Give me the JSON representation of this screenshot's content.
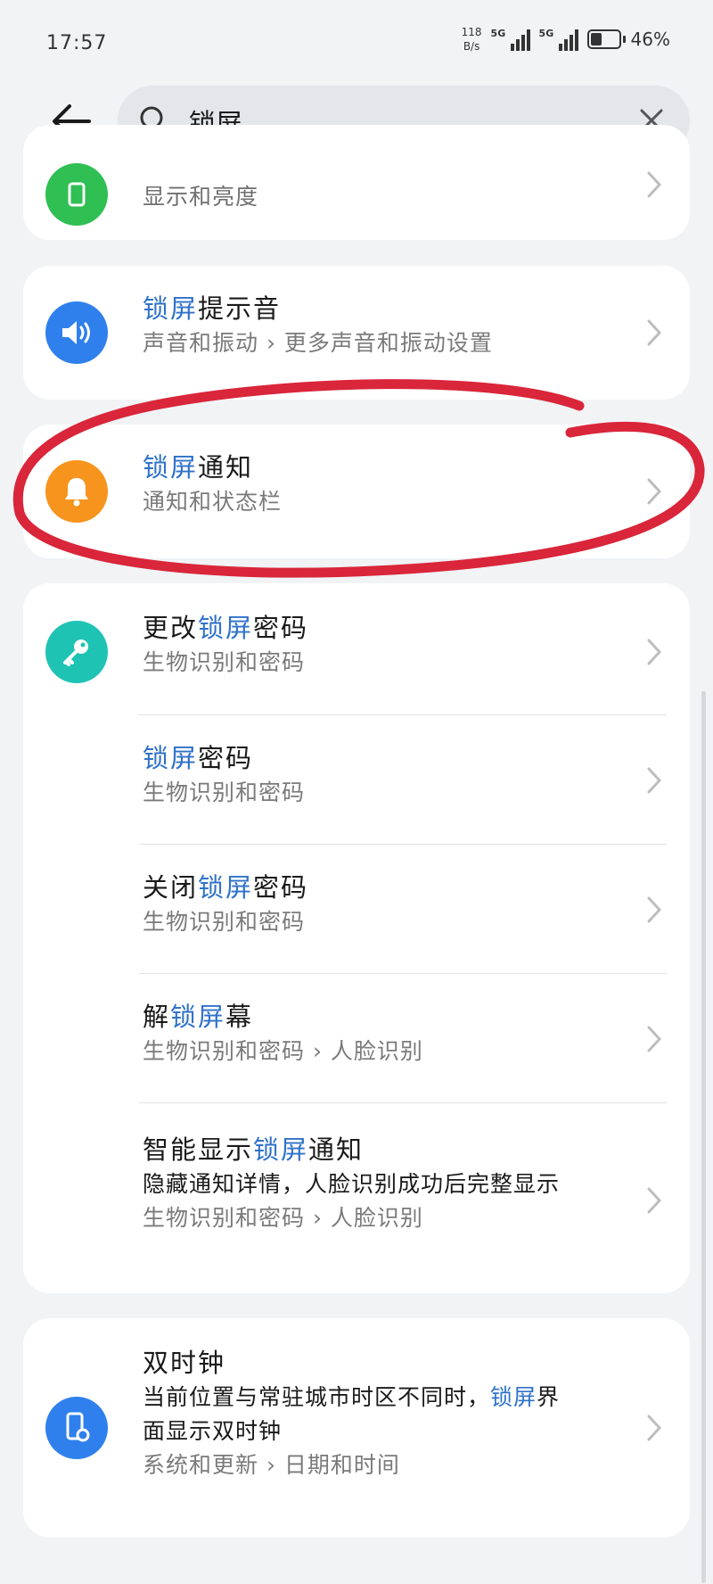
{
  "status_bar": {
    "time": "17:57",
    "net_speed_value": "118",
    "net_speed_unit": "B/s",
    "signal1": "5G",
    "signal2": "5G",
    "battery": "46%",
    "battery_level": 0.46
  },
  "search": {
    "query": "锁屏",
    "placeholder": "锁屏"
  },
  "results": [
    {
      "title_parts": [
        "",
        "",
        ""
      ],
      "sub": "显示和亮度",
      "icon": "display-icon",
      "color": "#2fbf53"
    },
    {
      "title_parts": [
        "",
        "锁屏",
        "提示音"
      ],
      "sub": "声音和振动 › 更多声音和振动设置",
      "icon": "speaker-icon",
      "color": "#2f80ed"
    },
    {
      "title_parts": [
        "",
        "锁屏",
        "通知"
      ],
      "sub": "通知和状态栏",
      "icon": "bell-icon",
      "color": "#f7941d"
    },
    {
      "title_parts": [
        "更改",
        "锁屏",
        "密码"
      ],
      "sub": "生物识别和密码",
      "icon": "key-icon",
      "color": "#1ec3b4"
    },
    {
      "title_parts": [
        "",
        "锁屏",
        "密码"
      ],
      "sub": "生物识别和密码"
    },
    {
      "title_parts": [
        "关闭",
        "锁屏",
        "密码"
      ],
      "sub": "生物识别和密码"
    },
    {
      "title_parts": [
        "解",
        "锁屏",
        "幕"
      ],
      "sub": "生物识别和密码 › 人脸识别"
    },
    {
      "title_parts": [
        "智能显示",
        "锁屏",
        "通知"
      ],
      "desc": "隐藏通知详情，人脸识别成功后完整显示",
      "sub": "生物识别和密码 › 人脸识别"
    },
    {
      "title_parts": [
        "双时钟",
        "",
        ""
      ],
      "desc_parts": [
        "当前位置与常驻城市时区不同时，",
        "锁屏",
        "界"
      ],
      "desc2": "面显示双时钟",
      "sub": "系统和更新 › 日期和时间",
      "icon": "phone-gear-icon",
      "color": "#2f80ed"
    }
  ],
  "highlight_color": "#2f72c9",
  "annotation_color": "#d9263a"
}
